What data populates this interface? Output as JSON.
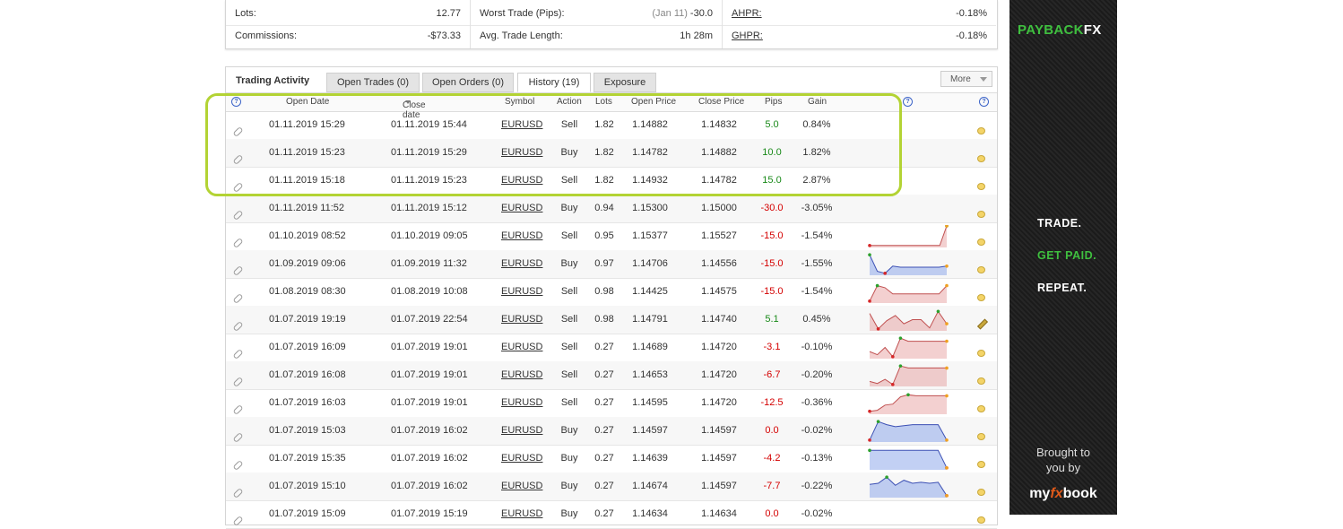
{
  "stats": {
    "col1": [
      {
        "label": "Lots:",
        "value": "12.77"
      },
      {
        "label": "Commissions:",
        "value": "-$73.33"
      }
    ],
    "col2": [
      {
        "label": "Worst Trade (Pips):",
        "dim": "(Jan 11)",
        "value": "-30.0"
      },
      {
        "label": "Avg. Trade Length:",
        "dim": "",
        "value": "1h 28m"
      }
    ],
    "col3": [
      {
        "label": "AHPR:",
        "value": "-0.18%"
      },
      {
        "label": "GHPR:",
        "value": "-0.18%"
      }
    ]
  },
  "panel": {
    "title": "Trading Activity",
    "tabs": [
      "Open Trades (0)",
      "Open Orders (0)",
      "History (19)",
      "Exposure"
    ],
    "active_tab": 2,
    "more_label": "More"
  },
  "columns": {
    "open_date": "Open Date",
    "close_date": "Close date",
    "symbol": "Symbol",
    "action": "Action",
    "lots": "Lots",
    "open_price": "Open Price",
    "close_price": "Close Price",
    "pips": "Pips",
    "gain": "Gain",
    "help_glyph": "?"
  },
  "trades": [
    {
      "open": "01.11.2019 15:29",
      "close": "01.11.2019 15:44",
      "symbol": "EURUSD",
      "action": "Sell",
      "lots": "1.82",
      "op": "1.14882",
      "cp": "1.14832",
      "pips": "5.0",
      "gain": "0.84%",
      "pos": true,
      "spark": null,
      "icon": "comment"
    },
    {
      "open": "01.11.2019 15:23",
      "close": "01.11.2019 15:29",
      "symbol": "EURUSD",
      "action": "Buy",
      "lots": "1.82",
      "op": "1.14782",
      "cp": "1.14882",
      "pips": "10.0",
      "gain": "1.82%",
      "pos": true,
      "spark": null,
      "icon": "comment"
    },
    {
      "open": "01.11.2019 15:18",
      "close": "01.11.2019 15:23",
      "symbol": "EURUSD",
      "action": "Sell",
      "lots": "1.82",
      "op": "1.14932",
      "cp": "1.14782",
      "pips": "15.0",
      "gain": "2.87%",
      "pos": true,
      "spark": null,
      "icon": "comment"
    },
    {
      "open": "01.11.2019 11:52",
      "close": "01.11.2019 15:12",
      "symbol": "EURUSD",
      "action": "Buy",
      "lots": "0.94",
      "op": "1.15300",
      "cp": "1.15000",
      "pips": "-30.0",
      "gain": "-3.05%",
      "pos": false,
      "spark": null,
      "icon": "comment"
    },
    {
      "open": "01.10.2019 08:52",
      "close": "01.10.2019 09:05",
      "symbol": "EURUSD",
      "action": "Sell",
      "lots": "0.95",
      "op": "1.15377",
      "cp": "1.15527",
      "pips": "-15.0",
      "gain": "-1.54%",
      "pos": false,
      "spark": {
        "color": "red",
        "pts": [
          0.95,
          0.95,
          0.95,
          0.95,
          0.95,
          0.95,
          0.95,
          0.95,
          0.95,
          0.95,
          0.95,
          0.0
        ]
      },
      "icon": "comment"
    },
    {
      "open": "01.09.2019 09:06",
      "close": "01.09.2019 11:32",
      "symbol": "EURUSD",
      "action": "Buy",
      "lots": "0.97",
      "op": "1.14706",
      "cp": "1.14556",
      "pips": "-15.0",
      "gain": "-1.55%",
      "pos": false,
      "spark": {
        "color": "blue",
        "pts": [
          0.05,
          0.85,
          0.95,
          0.6,
          0.65,
          0.65,
          0.65,
          0.65,
          0.65,
          0.65,
          0.6
        ]
      },
      "icon": "comment"
    },
    {
      "open": "01.08.2019 08:30",
      "close": "01.08.2019 10:08",
      "symbol": "EURUSD",
      "action": "Sell",
      "lots": "0.98",
      "op": "1.14425",
      "cp": "1.14575",
      "pips": "-15.0",
      "gain": "-1.54%",
      "pos": false,
      "spark": {
        "color": "red",
        "pts": [
          0.95,
          0.2,
          0.3,
          0.6,
          0.6,
          0.6,
          0.6,
          0.6,
          0.6,
          0.6,
          0.2
        ]
      },
      "icon": "comment"
    },
    {
      "open": "01.07.2019 19:19",
      "close": "01.07.2019 22:54",
      "symbol": "EURUSD",
      "action": "Sell",
      "lots": "0.98",
      "op": "1.14791",
      "cp": "1.14740",
      "pips": "5.1",
      "gain": "0.45%",
      "pos": true,
      "spark": {
        "color": "red",
        "pts": [
          0.2,
          0.95,
          0.55,
          0.3,
          0.7,
          0.5,
          0.5,
          0.9,
          0.1,
          0.7
        ]
      },
      "icon": "edit"
    },
    {
      "open": "01.07.2019 16:09",
      "close": "01.07.2019 19:01",
      "symbol": "EURUSD",
      "action": "Sell",
      "lots": "0.27",
      "op": "1.14689",
      "cp": "1.14720",
      "pips": "-3.1",
      "gain": "-0.10%",
      "pos": false,
      "spark": {
        "color": "red",
        "pts": [
          0.7,
          0.85,
          0.5,
          0.95,
          0.05,
          0.2,
          0.2,
          0.2,
          0.2,
          0.2,
          0.2
        ]
      },
      "icon": "comment"
    },
    {
      "open": "01.07.2019 16:08",
      "close": "01.07.2019 19:01",
      "symbol": "EURUSD",
      "action": "Sell",
      "lots": "0.27",
      "op": "1.14653",
      "cp": "1.14720",
      "pips": "-6.7",
      "gain": "-0.20%",
      "pos": false,
      "spark": {
        "color": "red",
        "pts": [
          0.8,
          0.9,
          0.7,
          0.95,
          0.05,
          0.15,
          0.15,
          0.15,
          0.15,
          0.15,
          0.15
        ]
      },
      "icon": "comment"
    },
    {
      "open": "01.07.2019 16:03",
      "close": "01.07.2019 19:01",
      "symbol": "EURUSD",
      "action": "Sell",
      "lots": "0.27",
      "op": "1.14595",
      "cp": "1.14720",
      "pips": "-12.5",
      "gain": "-0.36%",
      "pos": false,
      "spark": {
        "color": "red",
        "pts": [
          0.9,
          0.85,
          0.6,
          0.55,
          0.2,
          0.1,
          0.15,
          0.15,
          0.15,
          0.15,
          0.15
        ]
      },
      "icon": "comment"
    },
    {
      "open": "01.07.2019 15:03",
      "close": "01.07.2019 16:02",
      "symbol": "EURUSD",
      "action": "Buy",
      "lots": "0.27",
      "op": "1.14597",
      "cp": "1.14597",
      "pips": "0.0",
      "gain": "-0.02%",
      "pos": false,
      "spark": {
        "color": "blue",
        "pts": [
          0.95,
          0.05,
          0.2,
          0.3,
          0.25,
          0.2,
          0.2,
          0.2,
          0.2,
          0.95
        ]
      },
      "icon": "comment"
    },
    {
      "open": "01.07.2019 15:35",
      "close": "01.07.2019 16:02",
      "symbol": "EURUSD",
      "action": "Buy",
      "lots": "0.27",
      "op": "1.14639",
      "cp": "1.14597",
      "pips": "-4.2",
      "gain": "-0.13%",
      "pos": false,
      "spark": {
        "color": "blue",
        "pts": [
          0.1,
          0.1,
          0.1,
          0.1,
          0.1,
          0.1,
          0.1,
          0.1,
          0.1,
          0.95
        ]
      },
      "icon": "comment"
    },
    {
      "open": "01.07.2019 15:10",
      "close": "01.07.2019 16:02",
      "symbol": "EURUSD",
      "action": "Buy",
      "lots": "0.27",
      "op": "1.14674",
      "cp": "1.14597",
      "pips": "-7.7",
      "gain": "-0.22%",
      "pos": false,
      "spark": {
        "color": "blue",
        "pts": [
          0.4,
          0.35,
          0.05,
          0.45,
          0.2,
          0.35,
          0.3,
          0.35,
          0.3,
          0.95
        ]
      },
      "icon": "comment"
    },
    {
      "open": "01.07.2019 15:09",
      "close": "01.07.2019 15:19",
      "symbol": "EURUSD",
      "action": "Buy",
      "lots": "0.27",
      "op": "1.14634",
      "cp": "1.14634",
      "pips": "0.0",
      "gain": "-0.02%",
      "pos": false,
      "spark": null,
      "icon": "comment"
    }
  ],
  "ad": {
    "brand_a": "PAYBACK",
    "brand_b": "FX",
    "line1": "TRADE.",
    "line2": "GET PAID.",
    "line3": "REPEAT.",
    "brought_1": "Brought to",
    "brought_2": "you by",
    "mfb_a": "my",
    "mfb_b": "fx",
    "mfb_c": "book",
    "accent_green": "#3fbf3f"
  }
}
